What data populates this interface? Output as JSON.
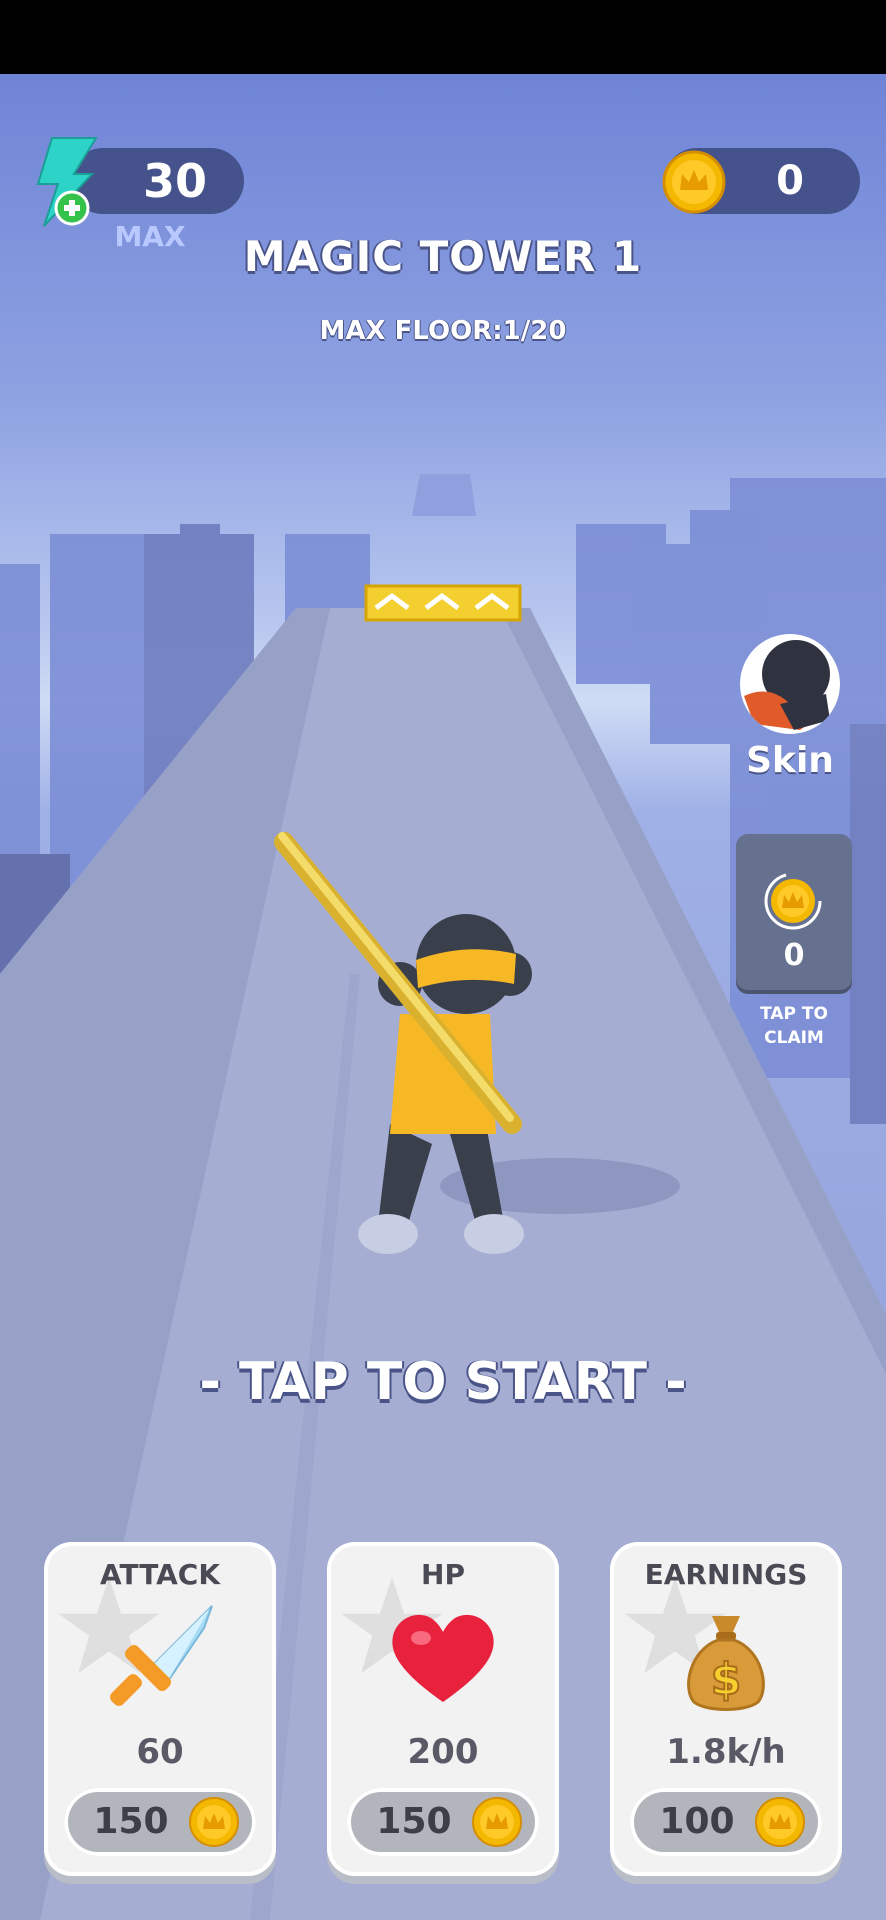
{
  "energy": {
    "value": "30",
    "status": "MAX"
  },
  "coins": {
    "value": "0"
  },
  "level": {
    "title": "MAGIC TOWER 1",
    "subtitle": "MAX FLOOR:1/20"
  },
  "skin": {
    "label": "Skin"
  },
  "claim": {
    "value": "0",
    "label": "TAP TO\nCLAIM"
  },
  "start_prompt": "- TAP TO START -",
  "upgrades": [
    {
      "title": "ATTACK",
      "icon": "sword-icon",
      "value": "60",
      "price": "150"
    },
    {
      "title": "HP",
      "icon": "heart-icon",
      "value": "200",
      "price": "150"
    },
    {
      "title": "EARNINGS",
      "icon": "money-bag-icon",
      "value": "1.8k/h",
      "price": "100"
    }
  ],
  "colors": {
    "gold": "#f5b800",
    "energy": "#2ed3c8",
    "plus": "#35c24a",
    "heart": "#e8213d",
    "character_shirt": "#f7b826"
  }
}
